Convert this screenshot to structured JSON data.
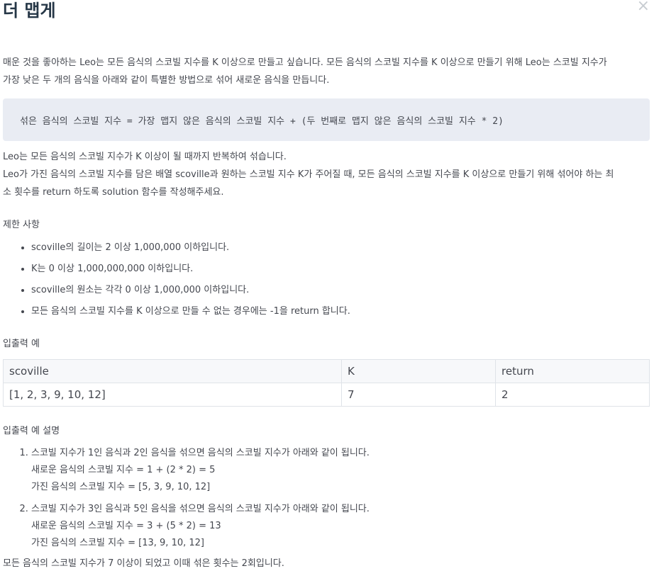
{
  "title": "더 맵게",
  "close_icon": "close-icon",
  "intro": {
    "line1": "매운 것을 좋아하는 Leo는 모든 음식의 스코빌 지수를 K 이상으로 만들고 싶습니다. 모든 음식의 스코빌 지수를 K 이상으로 만들기 위해 Leo는 스코빌 지수가",
    "line2": "가장 낮은 두 개의 음식을 아래와 같이 특별한 방법으로 섞어 새로운 음식을 만듭니다."
  },
  "formula": "섞은 음식의 스코빌 지수 = 가장 맵지 않은 음식의 스코빌 지수 + (두 번째로 맵지 않은 음식의 스코빌 지수 * 2)",
  "description": {
    "line1": "Leo는 모든 음식의 스코빌 지수가 K 이상이 될 때까지 반복하여 섞습니다.",
    "line2": "Leo가 가진 음식의 스코빌 지수를 담은 배열 scoville과 원하는 스코빌 지수 K가 주어질 때, 모든 음식의 스코빌 지수를 K 이상으로 만들기 위해 섞어야 하는 최",
    "line3": "소 횟수를 return 하도록 solution 함수를 작성해주세요."
  },
  "constraints": {
    "heading": "제한 사항",
    "items": [
      "scoville의 길이는 2 이상 1,000,000 이하입니다.",
      "K는 0 이상 1,000,000,000 이하입니다.",
      "scoville의 원소는 각각 0 이상 1,000,000 이하입니다.",
      "모든 음식의 스코빌 지수를 K 이상으로 만들 수 없는 경우에는 -1을 return 합니다."
    ]
  },
  "io_example": {
    "heading": "입출력 예",
    "columns": [
      "scoville",
      "K",
      "return"
    ],
    "rows": [
      [
        "[1, 2, 3, 9, 10, 12]",
        "7",
        "2"
      ]
    ]
  },
  "io_explanation": {
    "heading": "입출력 예 설명",
    "steps": [
      {
        "main": "스코빌 지수가 1인 음식과 2인 음식을 섞으면 음식의 스코빌 지수가 아래와 같이 됩니다.",
        "sub1": "새로운 음식의 스코빌 지수 = 1 + (2 * 2) = 5",
        "sub2": "가진 음식의 스코빌 지수 = [5, 3, 9, 10, 12]"
      },
      {
        "main": "스코빌 지수가 3인 음식과 5인 음식을 섞으면 음식의 스코빌 지수가 아래와 같이 됩니다.",
        "sub1": "새로운 음식의 스코빌 지수 = 3 + (5 * 2) = 13",
        "sub2": "가진 음식의 스코빌 지수 = [13, 9, 10, 12]"
      }
    ],
    "conclusion": "모든 음식의 스코빌 지수가 7 이상이 되었고 이때 섞은 횟수는 2회입니다."
  }
}
